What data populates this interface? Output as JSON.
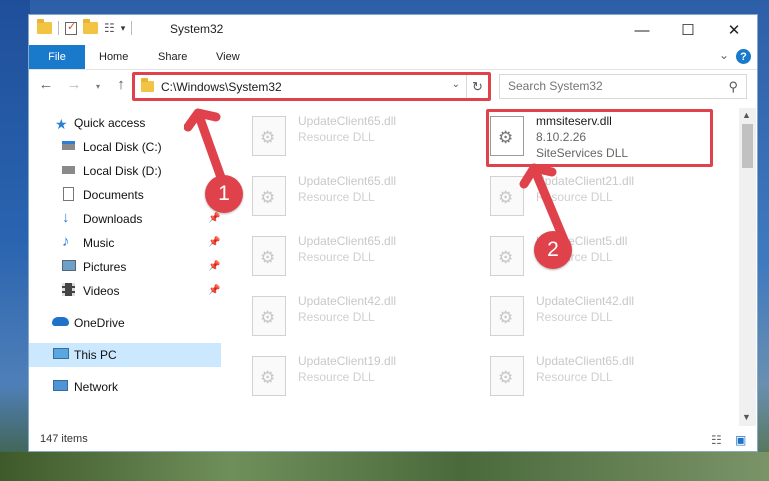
{
  "window": {
    "title": "System32"
  },
  "ribbon": {
    "file": "File",
    "home": "Home",
    "share": "Share",
    "view": "View"
  },
  "address": {
    "path": "C:\\Windows\\System32"
  },
  "search": {
    "placeholder": "Search System32"
  },
  "nav": {
    "items": [
      {
        "label": "Quick access",
        "icon": "star-icon"
      },
      {
        "label": "Local Disk (C:)",
        "icon": "drive-icon"
      },
      {
        "label": "Local Disk (D:)",
        "icon": "drive-icon"
      },
      {
        "label": "Documents",
        "icon": "documents-icon",
        "pinned": true
      },
      {
        "label": "Downloads",
        "icon": "download-icon",
        "pinned": true
      },
      {
        "label": "Music",
        "icon": "music-icon",
        "pinned": true
      },
      {
        "label": "Pictures",
        "icon": "pictures-icon",
        "pinned": true
      },
      {
        "label": "Videos",
        "icon": "videos-icon",
        "pinned": true
      },
      {
        "label": "OneDrive",
        "icon": "cloud-icon"
      },
      {
        "label": "This PC",
        "icon": "computer-icon",
        "selected": true
      },
      {
        "label": "Network",
        "icon": "network-icon"
      }
    ]
  },
  "files": {
    "highlighted": {
      "name": "mmsiteserv.dll",
      "version": "8.10.2.26",
      "desc": "SiteServices DLL"
    },
    "left": [
      {
        "name": "UpdateClient65.dll",
        "desc": "Resource DLL"
      },
      {
        "name": "UpdateClient65.dll",
        "desc": "Resource DLL"
      },
      {
        "name": "UpdateClient65.dll",
        "desc": "Resource DLL"
      },
      {
        "name": "UpdateClient42.dll",
        "desc": "Resource DLL"
      },
      {
        "name": "UpdateClient19.dll",
        "desc": "Resource DLL"
      }
    ],
    "right": [
      {
        "name": "UpdateClient21.dll",
        "desc": "Resource DLL"
      },
      {
        "name": "UpdateClient5.dll",
        "desc": "Resource DLL"
      },
      {
        "name": "UpdateClient42.dll",
        "desc": "Resource DLL"
      },
      {
        "name": "UpdateClient65.dll",
        "desc": "Resource DLL"
      }
    ]
  },
  "status": {
    "count": "147 items"
  },
  "annotations": {
    "step1": "1",
    "step2": "2",
    "color": "#e0424b"
  }
}
